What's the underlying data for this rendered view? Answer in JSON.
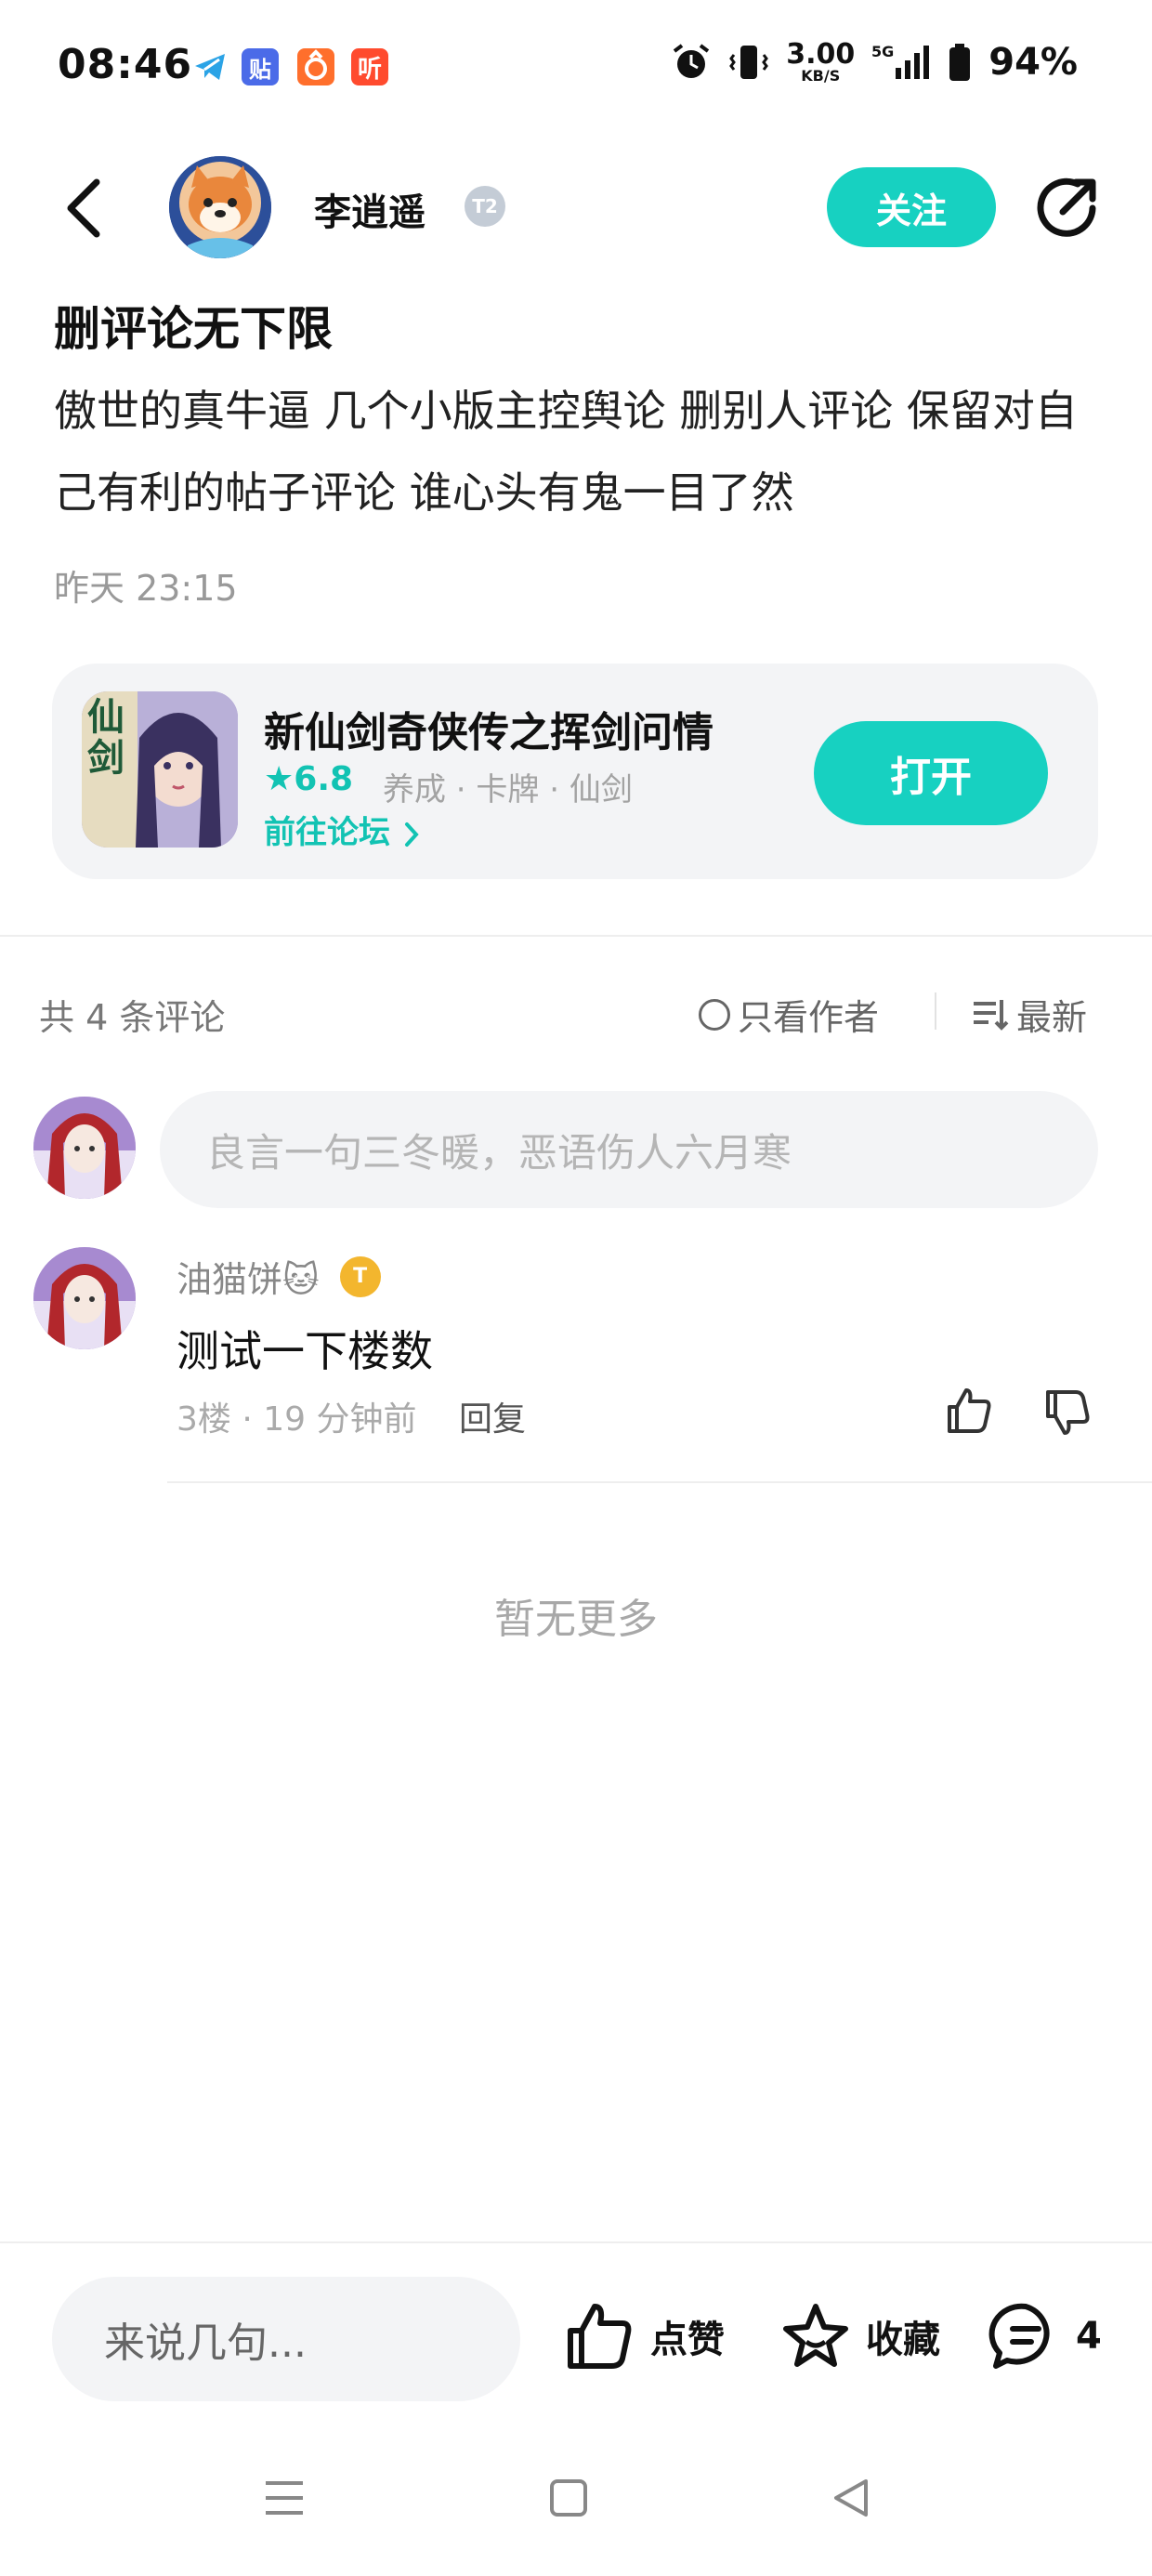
{
  "status_bar": {
    "time": "08:46",
    "notif_icons": [
      {
        "name": "telegram-icon",
        "color": "#2ba3e6"
      },
      {
        "name": "tieba-icon",
        "color": "#4b6be8",
        "glyph": "贴"
      },
      {
        "name": "app-icon",
        "color": "#ff6f2c"
      },
      {
        "name": "listen-app-icon",
        "color": "#ff4b2e",
        "glyph": "听"
      }
    ],
    "net_speed": "3.00",
    "net_unit": "KB/S",
    "network": "5G",
    "battery": "94%"
  },
  "header": {
    "username": "李逍遥",
    "level_badge": "T2",
    "follow_label": "关注"
  },
  "post": {
    "title": "删评论无下限",
    "body": "傲世的真牛逼 几个小版主控舆论 删别人评论 保留对自己有利的帖子评论 谁心头有鬼一目了然",
    "time": "昨天 23:15"
  },
  "game_card": {
    "name": "新仙剑奇侠传之挥剑问情",
    "rating": "6.8",
    "tags": "养成 · 卡牌 · 仙剑",
    "forum_link": "前往论坛",
    "open_label": "打开",
    "icon_text": "仙剑"
  },
  "comments_header": {
    "count_text": "共 4 条评论",
    "only_author": "只看作者",
    "sort": "最新"
  },
  "comment_input": {
    "placeholder": "良言一句三冬暖，恶语伤人六月寒"
  },
  "comments": [
    {
      "author": "油猫饼🐱",
      "badge": "T",
      "text": "测试一下楼数",
      "meta": "3楼 · 19 分钟前",
      "reply_label": "回复"
    }
  ],
  "no_more": "暂无更多",
  "bottom_bar": {
    "input_placeholder": "来说几句...",
    "like_label": "点赞",
    "fav_label": "收藏",
    "comment_count": "4"
  },
  "colors": {
    "accent": "#17d1c1",
    "accent_text": "#12c3b3"
  }
}
